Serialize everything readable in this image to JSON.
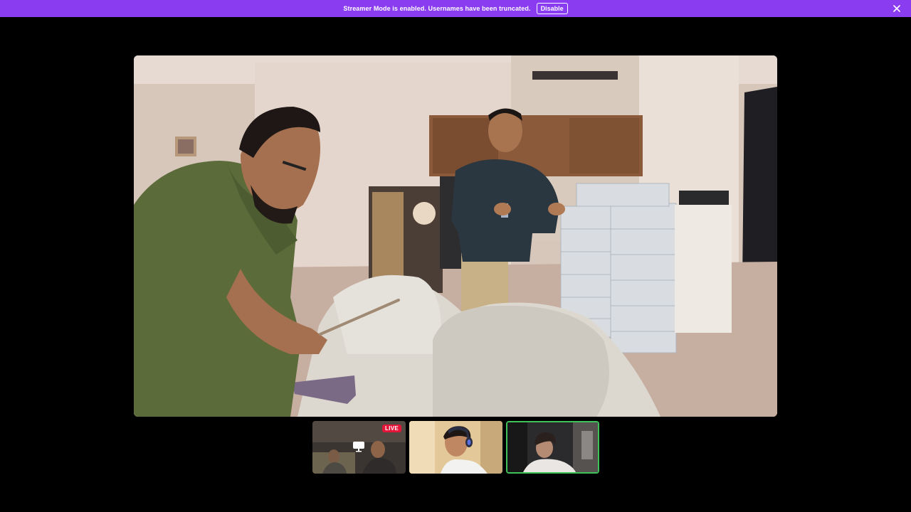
{
  "banner": {
    "message": "Streamer Mode is enabled. Usernames have been truncated.",
    "disable_label": "Disable",
    "background": "#8a3cf0"
  },
  "stage": {
    "content": "video-stream",
    "side_bubble_label": "+"
  },
  "participants": [
    {
      "id": "tile-1",
      "badge": "LIVE",
      "icon": "screen-share-icon",
      "active": false
    },
    {
      "id": "tile-2",
      "badge": "",
      "active": false
    },
    {
      "id": "tile-3",
      "badge": "",
      "active": true
    }
  ],
  "colors": {
    "live": "#e3163a",
    "active_border": "#3fc25a"
  }
}
